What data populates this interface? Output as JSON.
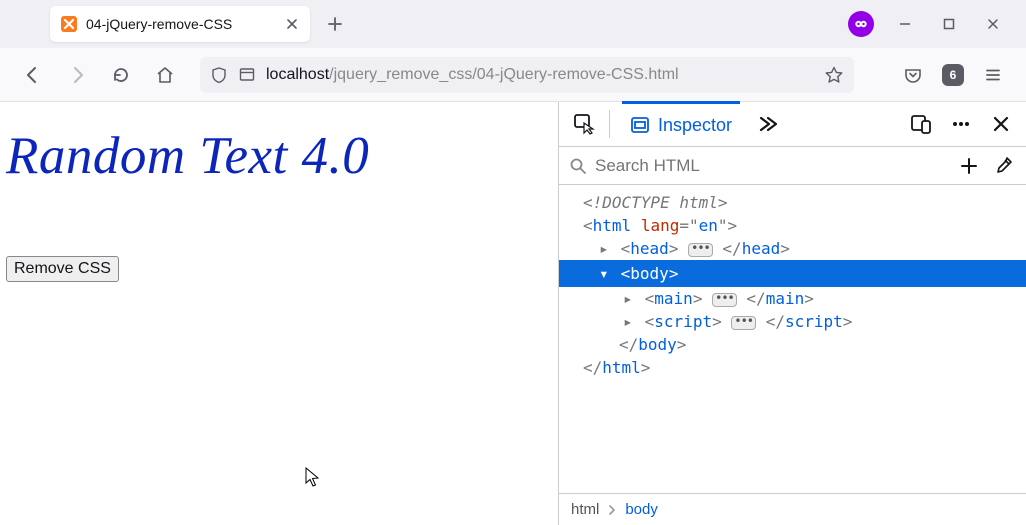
{
  "tab": {
    "title": "04-jQuery-remove-CSS"
  },
  "url": {
    "host": "localhost",
    "path": "/jquery_remove_css/04-jQuery-remove-CSS.html"
  },
  "toolbar": {
    "tab_count": "6"
  },
  "page": {
    "heading": "Random Text 4.0",
    "button_label": "Remove CSS"
  },
  "devtools": {
    "active_tab": "Inspector",
    "search_placeholder": "Search HTML",
    "tree": {
      "doctype": "<!DOCTYPE html>",
      "html_open": {
        "tag": "html",
        "attr_name": "lang",
        "attr_val": "en"
      },
      "head": {
        "tag": "head"
      },
      "body_open": {
        "tag": "body"
      },
      "main": {
        "tag": "main"
      },
      "script": {
        "tag": "script"
      },
      "body_close": {
        "tag": "body"
      },
      "html_close": {
        "tag": "html"
      }
    },
    "crumbs": {
      "c0": "html",
      "c1": "body"
    }
  },
  "icons": {
    "close_x": "×",
    "plus": "+",
    "ellipsis": "⋯",
    "chevron": "›",
    "triangle_right": "▸",
    "triangle_down": "▾",
    "pill": "•••"
  }
}
